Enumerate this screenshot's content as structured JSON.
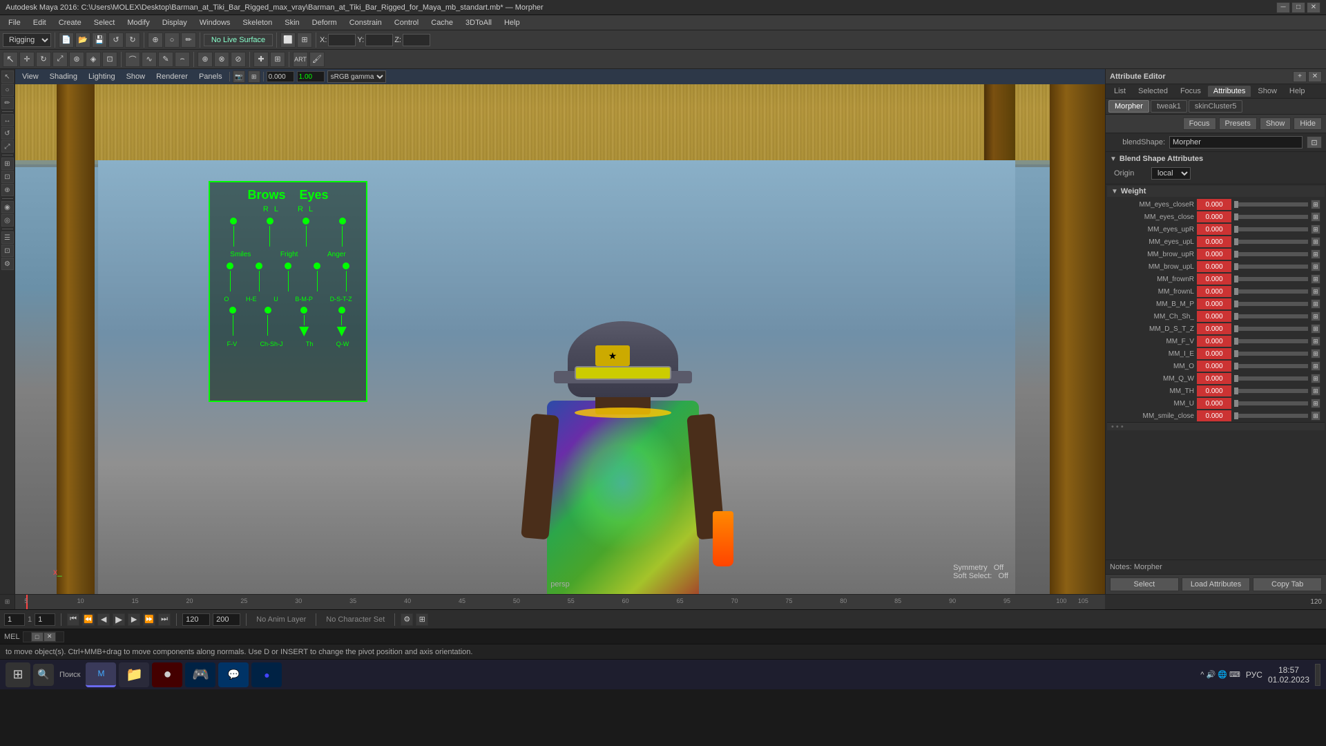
{
  "titlebar": {
    "title": "Autodesk Maya 2016: C:\\Users\\MOLEX\\Desktop\\Barman_at_Tiki_Bar_Rigged_max_vray\\Barman_at_Tiki_Bar_Rigged_for_Maya_mb_standart.mb* — Morpher",
    "min": "—",
    "max": "□",
    "close": "✕"
  },
  "menubar": {
    "items": [
      "File",
      "Edit",
      "Create",
      "Select",
      "Modify",
      "Display",
      "Windows",
      "Skeleton",
      "Skin",
      "Deform",
      "Constrain",
      "Control",
      "Cache",
      "3DToAll",
      "Help"
    ]
  },
  "toolbar1": {
    "mode": "Rigging",
    "livesurface": "No Live Surface",
    "x_label": "X:",
    "y_label": "Y:",
    "z_label": "Z:"
  },
  "viewport": {
    "panels": [
      "View",
      "Shading",
      "Lighting",
      "Show",
      "Renderer",
      "Panels"
    ],
    "gamma": "sRGB gamma",
    "value1": "0.000",
    "value2": "1.00"
  },
  "control_panel": {
    "brows_label": "Brows",
    "eyes_label": "Eyes",
    "r_label": "R",
    "l_label": "L",
    "r2_label": "R",
    "l2_label": "L",
    "row1": [
      "Smiles",
      "Fright",
      "Anger"
    ],
    "row2": [
      "O",
      "H-E",
      "U",
      "B-M-P",
      "D-S-T-Z"
    ],
    "row3": [
      "F-V",
      "Ch-Sh-J",
      "Th",
      "Q-W"
    ]
  },
  "symmetry": {
    "label": "Symmetry",
    "value": "Off",
    "soft_label": "Soft Select:",
    "soft_value": "Off"
  },
  "attribute_editor": {
    "title": "Attribute Editor",
    "expand": "+",
    "close": "✕",
    "tabs": [
      "List",
      "Selected",
      "Focus",
      "Attributes",
      "Show",
      "Help"
    ],
    "subtabs": [
      "Morpher",
      "tweak1",
      "skinCluster5"
    ],
    "buttons": {
      "focus": "Focus",
      "presets": "Presets",
      "show": "Show",
      "hide": "Hide"
    },
    "blendshape_label": "blendShape:",
    "blendshape_value": "Morpher",
    "sections": {
      "blend_shape_attributes": "Blend Shape Attributes",
      "origin_label": "Origin",
      "origin_value": "local",
      "weight": "Weight"
    },
    "weights": [
      {
        "name": "MM_eyes_closeR",
        "value": "0.000"
      },
      {
        "name": "MM_eyes_close",
        "value": "0.000"
      },
      {
        "name": "MM_eyes_upR",
        "value": "0.000"
      },
      {
        "name": "MM_eyes_upL",
        "value": "0.000"
      },
      {
        "name": "MM_brow_upR",
        "value": "0.000"
      },
      {
        "name": "MM_brow_upL",
        "value": "0.000"
      },
      {
        "name": "MM_frownR",
        "value": "0.000"
      },
      {
        "name": "MM_frownL",
        "value": "0.000"
      },
      {
        "name": "MM_B_M_P",
        "value": "0.000"
      },
      {
        "name": "MM_Ch_Sh_",
        "value": "0.000"
      },
      {
        "name": "MM_D_S_T_Z",
        "value": "0.000"
      },
      {
        "name": "MM_F_V",
        "value": "0.000"
      },
      {
        "name": "MM_I_E",
        "value": "0.000"
      },
      {
        "name": "MM_O",
        "value": "0.000"
      },
      {
        "name": "MM_Q_W",
        "value": "0.000"
      },
      {
        "name": "MM_TH",
        "value": "0.000"
      },
      {
        "name": "MM_U",
        "value": "0.000"
      },
      {
        "name": "MM_smile_close",
        "value": "0.000"
      }
    ],
    "notes_label": "Notes: Morpher",
    "bottom_buttons": {
      "select": "Select",
      "load_attributes": "Load Attributes",
      "copy_tab": "Copy Tab"
    }
  },
  "timeline": {
    "markers": [
      "5",
      "10",
      "15",
      "20",
      "25",
      "30",
      "35",
      "40",
      "45",
      "50",
      "55",
      "60",
      "65",
      "70",
      "75",
      "80",
      "85",
      "90",
      "95",
      "100",
      "105"
    ],
    "start": "1",
    "end": "120",
    "current": "1",
    "range_start": "1",
    "range_end": "120",
    "range_end2": "200"
  },
  "bottom_toolbar": {
    "anim_layer": "No Anim Layer",
    "char_set": "No Character Set"
  },
  "mel_bar": {
    "label": "MEL",
    "status_text": "to move object(s). Ctrl+MMB+drag to move components along normals. Use D or INSERT to change the pivot position and axis orientation."
  },
  "taskbar": {
    "time": "18:57",
    "date": "01.02.2023",
    "lang": "РУС",
    "apps": [
      "⊞",
      "🔍",
      "M",
      "📁",
      "●",
      "🎮",
      "💬",
      "🔵"
    ]
  },
  "icons": {
    "arrow": "▶",
    "down": "▼",
    "up": "▲",
    "collapse": "▼",
    "expand": "▶",
    "play": "▶",
    "stop": "■",
    "prev": "◀",
    "next": "▶",
    "first": "⏮",
    "last": "⏭"
  }
}
